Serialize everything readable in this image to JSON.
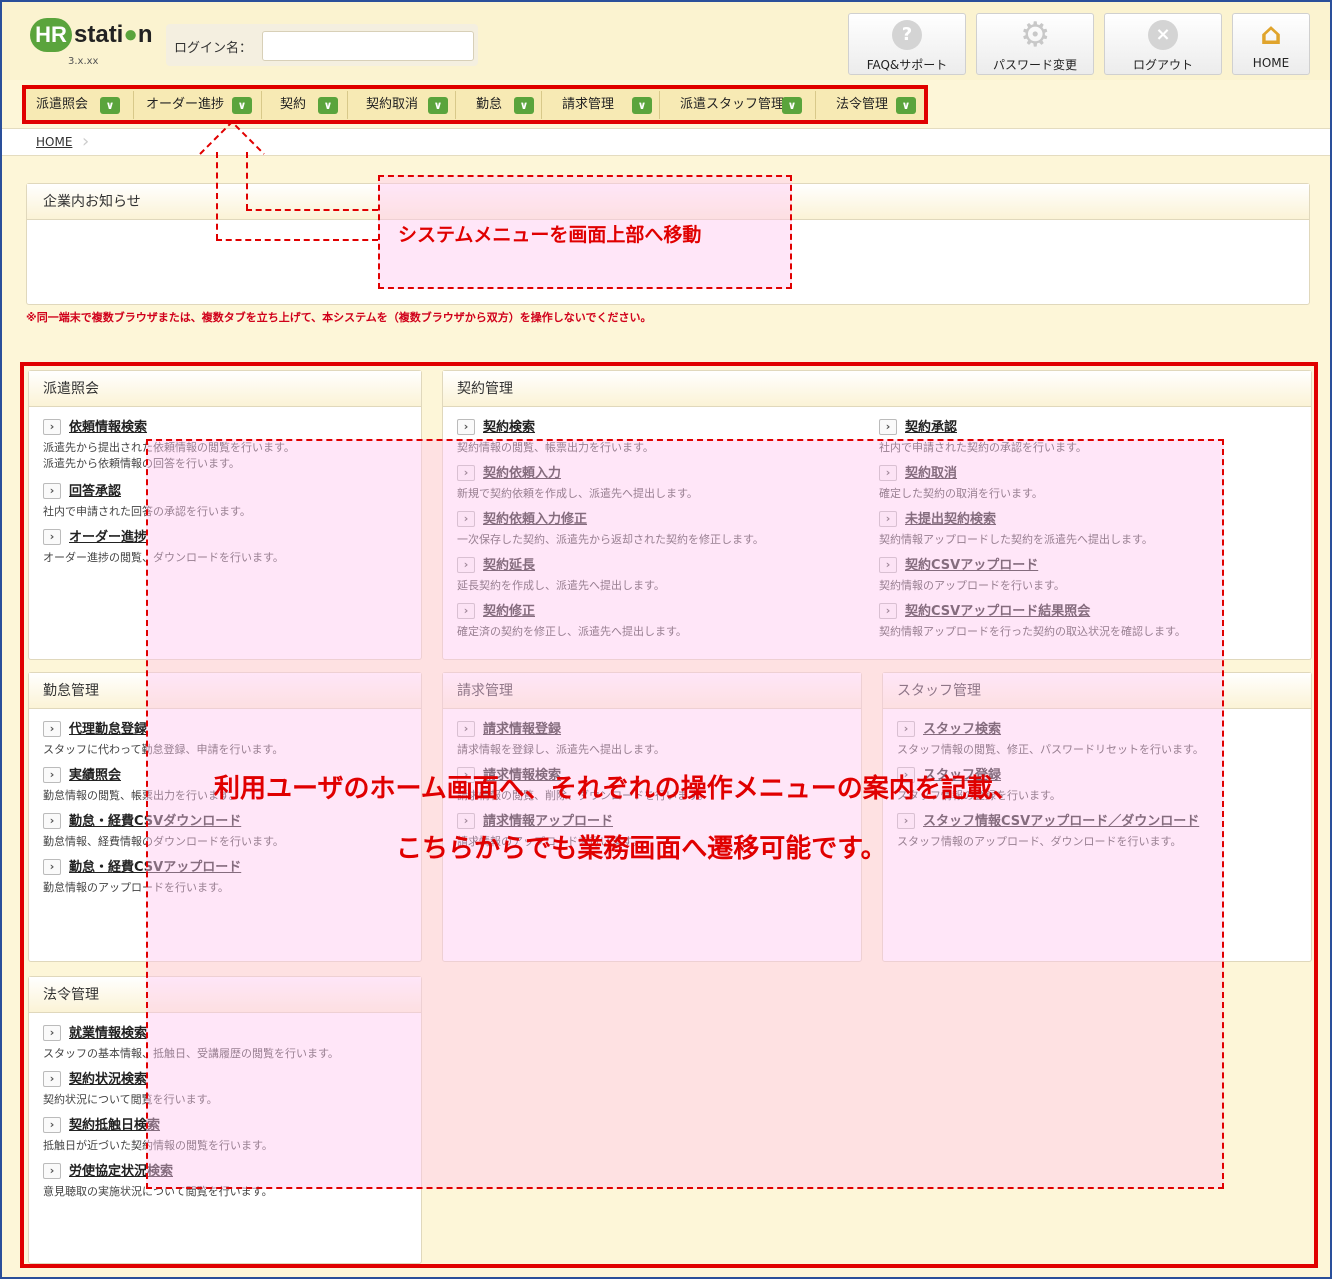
{
  "header": {
    "logo_hr": "HR",
    "logo_station_a": "stati",
    "logo_station_b": "●",
    "logo_station_c": "n",
    "version": "3.x.xx",
    "login_label": "ログイン名：",
    "login_value": "",
    "buttons": [
      {
        "label": "FAQ&サポート",
        "icon": "question-icon"
      },
      {
        "label": "パスワード変更",
        "icon": "gear-icon"
      },
      {
        "label": "ログアウト",
        "icon": "logout-icon"
      },
      {
        "label": "HOME",
        "icon": "home-icon"
      }
    ]
  },
  "menu": {
    "items": [
      "派遣照会",
      "オーダー進捗",
      "契約",
      "契約取消",
      "勤怠",
      "請求管理",
      "派遣スタッフ管理",
      "法令管理"
    ],
    "chevron": "∨"
  },
  "breadcrumb": {
    "home": "HOME"
  },
  "notice": {
    "title": "企業内お知らせ",
    "warning": "※同一端末で複数ブラウザまたは、複数タブを立ち上げて、本システムを（複数ブラウザから双方）を操作しないでください。"
  },
  "panels": {
    "haken": {
      "title": "派遣照会",
      "entries": [
        {
          "link": "依頼情報検索",
          "desc": [
            "派遣先から提出された依頼情報の閲覧を行います。",
            "派遣先から依頼情報の回答を行います。"
          ]
        },
        {
          "link": "回答承認",
          "desc": [
            "社内で申請された回答の承認を行います。"
          ]
        },
        {
          "link": "オーダー進捗",
          "desc": [
            "オーダー進捗の閲覧、ダウンロードを行います。"
          ]
        }
      ]
    },
    "keiyaku": {
      "title": "契約管理",
      "left": [
        {
          "link": "契約検索",
          "desc": "契約情報の閲覧、帳票出力を行います。"
        },
        {
          "link": "契約依頼入力",
          "desc": "新規で契約依頼を作成し、派遣先へ提出します。"
        },
        {
          "link": "契約依頼入力修正",
          "desc": "一次保存した契約、派遣先から返却された契約を修正します。"
        },
        {
          "link": "契約延長",
          "desc": "延長契約を作成し、派遣先へ提出します。"
        },
        {
          "link": "契約修正",
          "desc": "確定済の契約を修正し、派遣先へ提出します。"
        }
      ],
      "right": [
        {
          "link": "契約承認",
          "desc": "社内で申請された契約の承認を行います。"
        },
        {
          "link": "契約取消",
          "desc": "確定した契約の取消を行います。"
        },
        {
          "link": "未提出契約検索",
          "desc": "契約情報アップロードした契約を派遣先へ提出します。"
        },
        {
          "link": "契約CSVアップロード",
          "desc": "契約情報のアップロードを行います。"
        },
        {
          "link": "契約CSVアップロード結果照会",
          "desc": "契約情報アップロードを行った契約の取込状況を確認します。"
        }
      ]
    },
    "kintai": {
      "title": "勤怠管理",
      "entries": [
        {
          "link": "代理勤怠登録",
          "desc": "スタッフに代わって勤怠登録、申請を行います。"
        },
        {
          "link": "実績照会",
          "desc": "勤怠情報の閲覧、帳票出力を行います。"
        },
        {
          "link": "勤怠・経費CSVダウンロード",
          "desc": "勤怠情報、経費情報のダウンロードを行います。"
        },
        {
          "link": "勤怠・経費CSVアップロード",
          "desc": "勤怠情報のアップロードを行います。"
        }
      ]
    },
    "seikyu": {
      "title": "請求管理",
      "entries": [
        {
          "link": "請求情報登録",
          "desc": "請求情報を登録し、派遣先へ提出します。"
        },
        {
          "link": "請求情報検索",
          "desc": "請求情報の閲覧、削除、ダウンロードを行います。"
        },
        {
          "link": "請求情報アップロード",
          "desc": "請求情報のアップロードを行います。"
        }
      ]
    },
    "staff": {
      "title": "スタッフ管理",
      "entries": [
        {
          "link": "スタッフ検索",
          "desc": "スタッフ情報の閲覧、修正、パスワードリセットを行います。"
        },
        {
          "link": "スタッフ登録",
          "desc": "スタッフ情報の登録を行います。"
        },
        {
          "link": "スタッフ情報CSVアップロード／ダウンロード",
          "desc": "スタッフ情報のアップロード、ダウンロードを行います。"
        }
      ]
    },
    "horei": {
      "title": "法令管理",
      "entries": [
        {
          "link": "就業情報検索",
          "desc": "スタッフの基本情報、抵触日、受講履歴の閲覧を行います。"
        },
        {
          "link": "契約状況検索",
          "desc": "契約状況について閲覧を行います。"
        },
        {
          "link": "契約抵触日検索",
          "desc": "抵触日が近づいた契約情報の閲覧を行います。"
        },
        {
          "link": "労使協定状況検索",
          "desc": "意見聴取の実施状況について閲覧を行います。"
        }
      ]
    }
  },
  "annotations": {
    "top": "システムメニューを画面上部へ移動",
    "center_1": "利用ユーザのホーム画面へ、それぞれの操作メニューの案内を記載、",
    "center_2": "こちらからでも業務画面へ遷移可能です。"
  },
  "colors": {
    "accent_red": "#e00000",
    "chevron_green": "#5aa43c",
    "background": "#fdf6d8"
  }
}
